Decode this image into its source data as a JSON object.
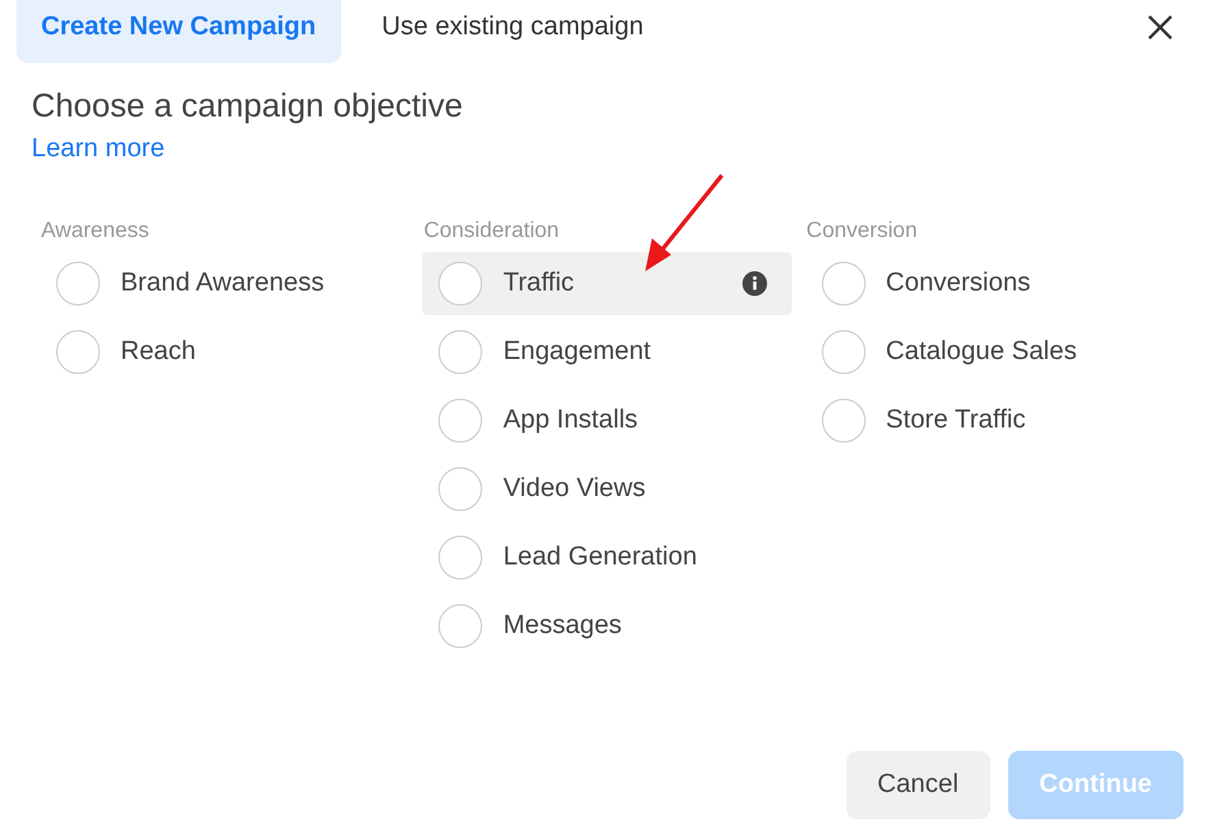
{
  "tabs": [
    {
      "label": "Create New Campaign",
      "selected": true
    },
    {
      "label": "Use existing campaign",
      "selected": false
    }
  ],
  "heading": "Choose a campaign objective",
  "learn_more": "Learn more",
  "columns": [
    {
      "title": "Awareness",
      "options": [
        {
          "label": "Brand Awareness",
          "highlighted": false,
          "selected": false
        },
        {
          "label": "Reach",
          "highlighted": false,
          "selected": false
        }
      ]
    },
    {
      "title": "Consideration",
      "options": [
        {
          "label": "Traffic",
          "highlighted": true,
          "selected": false
        },
        {
          "label": "Engagement",
          "highlighted": false,
          "selected": false
        },
        {
          "label": "App Installs",
          "highlighted": false,
          "selected": false
        },
        {
          "label": "Video Views",
          "highlighted": false,
          "selected": false
        },
        {
          "label": "Lead Generation",
          "highlighted": false,
          "selected": false
        },
        {
          "label": "Messages",
          "highlighted": false,
          "selected": false
        }
      ]
    },
    {
      "title": "Conversion",
      "options": [
        {
          "label": "Conversions",
          "highlighted": false,
          "selected": false
        },
        {
          "label": "Catalogue Sales",
          "highlighted": false,
          "selected": false
        },
        {
          "label": "Store Traffic",
          "highlighted": false,
          "selected": false
        }
      ]
    }
  ],
  "buttons": [
    {
      "label": "Cancel",
      "kind": "secondary",
      "disabled": false
    },
    {
      "label": "Continue",
      "kind": "primary",
      "disabled": true
    }
  ]
}
